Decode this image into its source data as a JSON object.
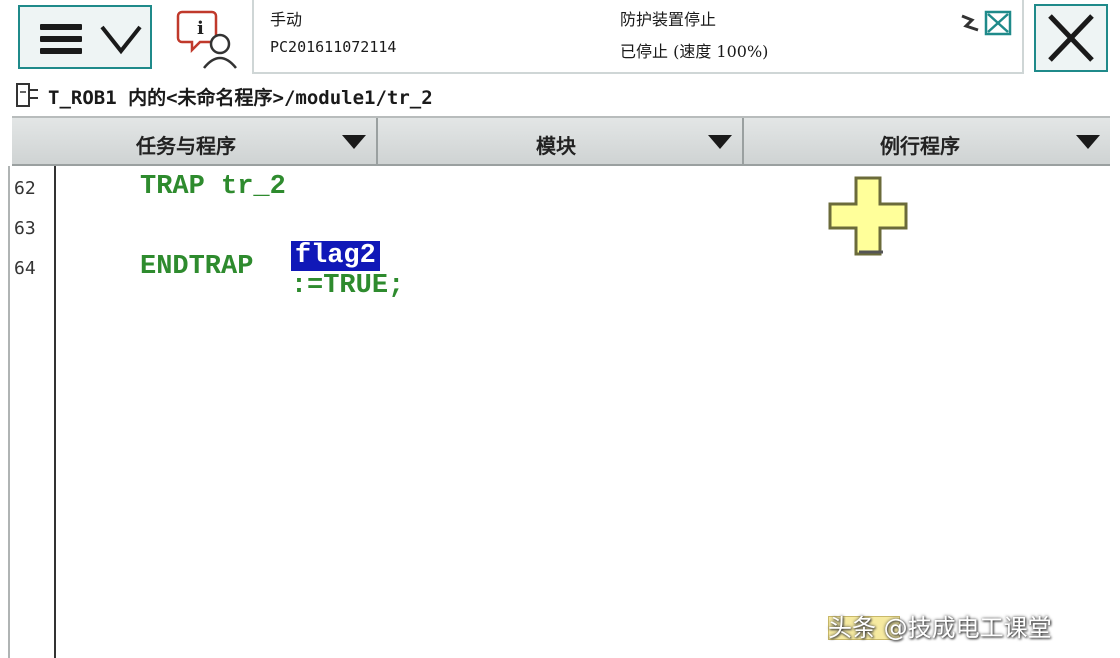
{
  "header": {
    "mode": "手动",
    "controller": "PC201611072114",
    "state": "防护装置停止",
    "speed_status": "已停止 (速度 100%)"
  },
  "breadcrumb": {
    "path": "T_ROB1 内的<未命名程序>/module1/tr_2"
  },
  "tabs": [
    {
      "label": "任务与程序"
    },
    {
      "label": "模块"
    },
    {
      "label": "例行程序"
    }
  ],
  "editor": {
    "lines": [
      {
        "number": "62",
        "code": "TRAP tr_2"
      },
      {
        "number": "63",
        "selected": "flag2",
        "code": ":=TRUE;"
      },
      {
        "number": "64",
        "code": "ENDTRAP"
      }
    ]
  },
  "watermark": {
    "text": "头条 @技成电工课堂"
  },
  "icons": {
    "menu": "hamburger-menu-icon",
    "dropdown": "chevron-down-icon",
    "info": "info-user-icon",
    "status_small": "robot-status-icon",
    "close": "close-icon",
    "program": "program-module-icon",
    "cursor": "plus-cursor-icon"
  },
  "colors": {
    "code_keyword": "#2e8b2e",
    "selection": "#1018b8",
    "accent_border": "#1f8a8a"
  }
}
